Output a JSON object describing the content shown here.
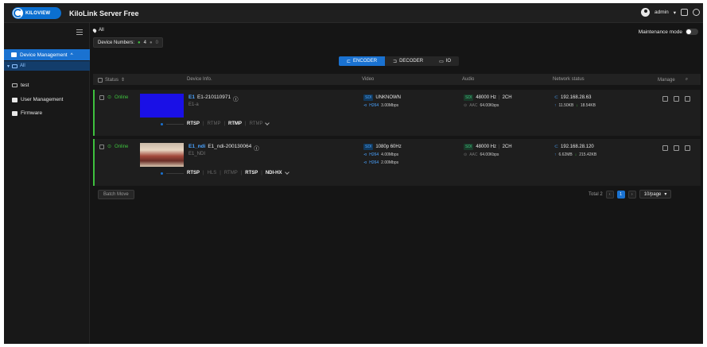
{
  "topbar": {
    "logo_text": "KILOVIEW",
    "app_title": "KiloLink Server Free",
    "user_name": "admin"
  },
  "sidebar": {
    "items": [
      {
        "label": "Device Management"
      },
      {
        "label": "All"
      },
      {
        "label": "test"
      },
      {
        "label": "User Management"
      },
      {
        "label": "Firmware"
      }
    ]
  },
  "main": {
    "breadcrumb": "All",
    "maintenance_label": "Maintenance mode",
    "device_numbers_label": "Device Numbers:",
    "online_count": "4",
    "offline_count": "0",
    "tabs": [
      {
        "label": "ENCODER"
      },
      {
        "label": "DECODER"
      },
      {
        "label": "IO"
      }
    ],
    "columns": {
      "status": "Status",
      "device": "Device Info.",
      "video": "Video",
      "audio": "Audio",
      "network": "Network status",
      "manage": "Manage"
    },
    "devices": [
      {
        "status": "Online",
        "id": "E1",
        "name": "E1-210110971",
        "sub": "E1-a",
        "streams": [
          "RTSP",
          "RTMP",
          "RTMP",
          "RTMP"
        ],
        "sdi": "SDI",
        "video_res": "UNKNOWN",
        "video_codecs": [
          {
            "codec": "H264",
            "rate": "3.00Mbps"
          }
        ],
        "audio_src": "SDI",
        "audio_rate": "48000 Hz",
        "audio_ch": "2CH",
        "aac_label": "AAC",
        "aac_rate": "64.00Kbps",
        "ip": "192.168.28.63",
        "up": "11.50KB",
        "down": "18.54KB"
      },
      {
        "status": "Online",
        "id": "E1_ndi",
        "name": "E1_ndi-200130064",
        "sub": "E1_NDI",
        "streams": [
          "RTSP",
          "HLS",
          "RTMP",
          "RTSP",
          "NDI-HX"
        ],
        "sdi": "SDI",
        "video_res": "1080p 60Hz",
        "video_codecs": [
          {
            "codec": "H264",
            "rate": "4.00Mbps"
          },
          {
            "codec": "H264",
            "rate": "2.00Mbps"
          }
        ],
        "audio_src": "SDI",
        "audio_rate": "48000 Hz",
        "audio_ch": "2CH",
        "aac_label": "AAC",
        "aac_rate": "64.00Kbps",
        "ip": "192.168.28.120",
        "up": "6.62MB",
        "down": "215.42KB"
      }
    ],
    "batch_label": "Batch Move",
    "total_label": "Total 2",
    "page": "1",
    "page_size": "10/page"
  }
}
